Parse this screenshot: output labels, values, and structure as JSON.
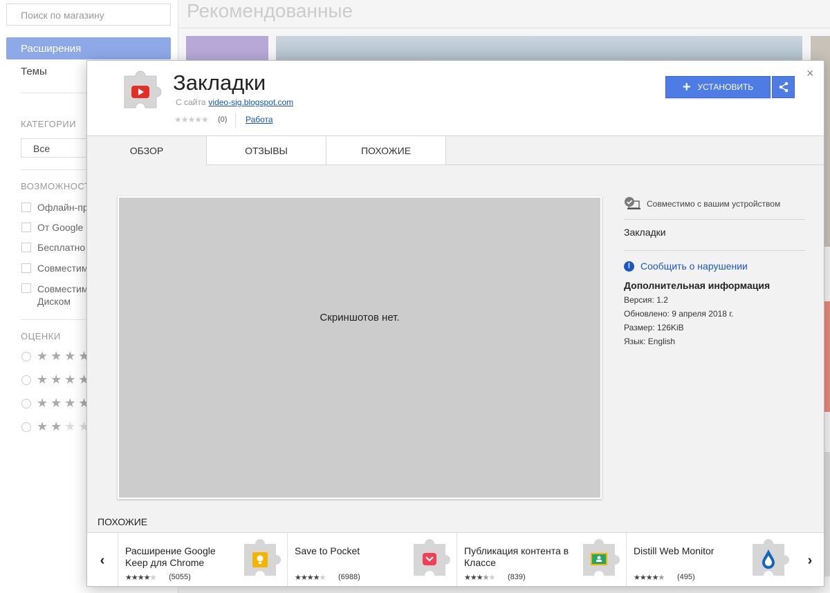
{
  "store": {
    "search_placeholder": "Поиск по магазину",
    "nav_extensions": "Расширения",
    "nav_themes": "Темы",
    "categories_heading": "КАТЕГОРИИ",
    "category_selected": "Все",
    "features_heading": "ВОЗМОЖНОСТИ",
    "features": [
      "Офлайн-пр",
      "От Google",
      "Бесплатно",
      "Совместим",
      "Совместим Диском"
    ],
    "ratings_heading": "ОЦЕНКИ",
    "recommended_title": "Рекомендованные"
  },
  "modal": {
    "title": "Закладки",
    "from_site_label": "С сайта",
    "site_link": "video-sig.blogspot.com",
    "rating_count": "(0)",
    "category_link": "Работа",
    "install_label": "УСТАНОВИТЬ",
    "close": "×",
    "tabs": [
      {
        "label": "ОБЗОР"
      },
      {
        "label": "ОТЗЫВЫ"
      },
      {
        "label": "ПОХОЖИЕ"
      }
    ],
    "no_screenshots": "Скриншотов нет.",
    "compatible": "Совместимо с вашим устройством",
    "side_name": "Закладки",
    "report": "Сообщить о нарушении",
    "additional_heading": "Дополнительная информация",
    "info": {
      "version": "Версия: 1.2",
      "updated": "Обновлено: 9 апреля 2018 г.",
      "size": "Размер: 126KiB",
      "language": "Язык: English"
    },
    "similar_heading": "ПОХОЖИЕ",
    "similar": [
      {
        "name": "Расширение Google Keep для Chrome",
        "rating": 4,
        "count": "(5055)",
        "icon": "keep-icon",
        "color": "#f6b400"
      },
      {
        "name": "Save to Pocket",
        "rating": 4,
        "count": "(6988)",
        "icon": "pocket-icon",
        "color": "#ef4056"
      },
      {
        "name": "Публикация контента в Классе",
        "rating": 3.5,
        "count": "(839)",
        "icon": "classroom-icon",
        "color": "#25a667"
      },
      {
        "name": "Distill Web Monitor",
        "rating": 4.5,
        "count": "(495)",
        "icon": "distill-icon",
        "color": "#1565c0"
      }
    ]
  },
  "colors": {
    "accent": "#4d7ce5",
    "link": "#1155cc",
    "nav_selected": "#8ea9e8"
  }
}
